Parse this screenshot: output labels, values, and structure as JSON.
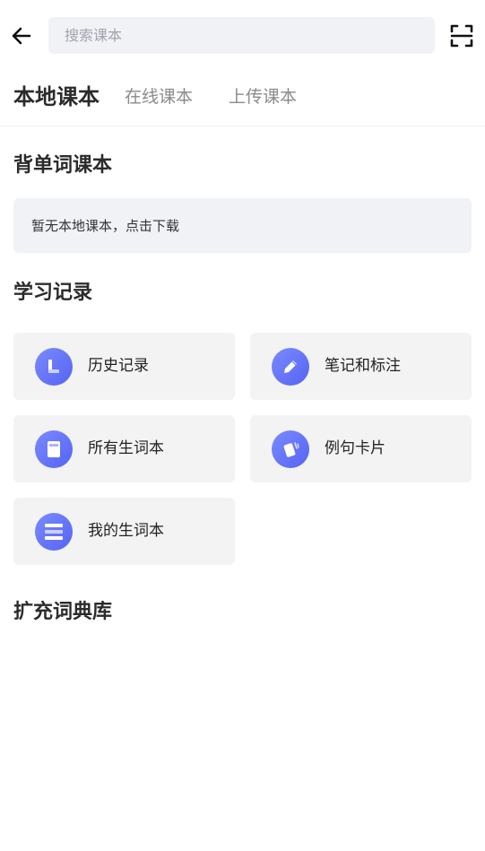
{
  "header": {
    "back_icon": "arrow-left-icon",
    "search_placeholder": "搜索课本",
    "search_value": "",
    "scan_icon": "scan-icon"
  },
  "tabs": [
    {
      "label": "本地课本",
      "active": true
    },
    {
      "label": "在线课本",
      "active": false
    },
    {
      "label": "上传课本",
      "active": false
    }
  ],
  "sections": {
    "textbooks": {
      "title": "背单词课本",
      "empty_text": "暂无本地课本，点击下载"
    },
    "study_records": {
      "title": "学习记录",
      "items": [
        {
          "label": "历史记录",
          "icon": "history-icon"
        },
        {
          "label": "笔记和标注",
          "icon": "pencil-icon"
        },
        {
          "label": "所有生词本",
          "icon": "notebook-icon"
        },
        {
          "label": "例句卡片",
          "icon": "cards-icon"
        },
        {
          "label": "我的生词本",
          "icon": "list-icon"
        }
      ]
    },
    "dictionaries": {
      "title": "扩充词典库"
    }
  },
  "colors": {
    "accent_gradient_start": "#7a8bff",
    "accent_gradient_end": "#5563f3",
    "search_bg": "#f1f2f6",
    "card_bg": "#f3f3f4"
  }
}
